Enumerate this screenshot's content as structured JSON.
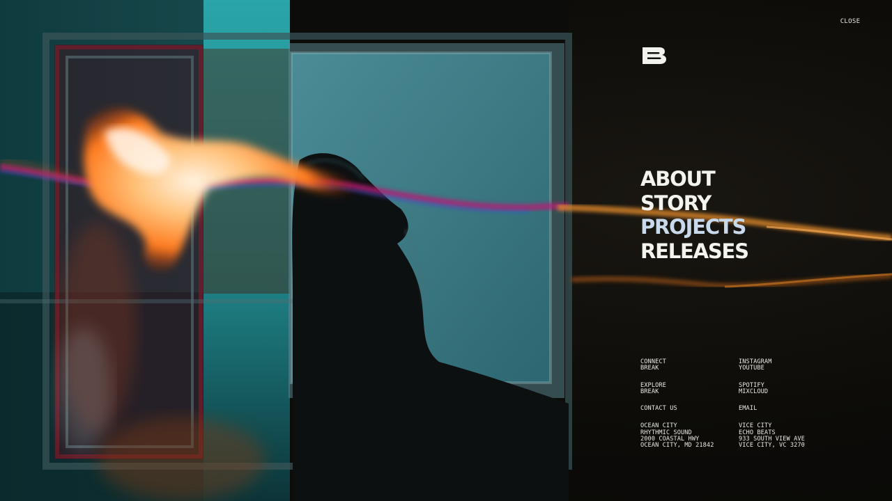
{
  "header": {
    "close_label": "CLOSE"
  },
  "logo": {
    "icon": "b-logo-icon",
    "color": "#f2f2ee"
  },
  "main_nav": {
    "items": [
      {
        "label": "ABOUT"
      },
      {
        "label": "STORY"
      },
      {
        "label": "PROJECTS",
        "active": true
      },
      {
        "label": "RELEASES"
      }
    ],
    "active_color": "#c7d9ea"
  },
  "footer": {
    "connect": {
      "line1": "CONNECT",
      "line2": "BREAK"
    },
    "social": {
      "instagram": "INSTAGRAM",
      "youtube": "YOUTUBE"
    },
    "explore": {
      "line1": "EXPLORE",
      "line2": "BREAK"
    },
    "music": {
      "spotify": "SPOTIFY",
      "mixcloud": "MIXCLOUD"
    },
    "contact": {
      "label": "CONTACT US",
      "email": "EMAIL"
    },
    "studios": [
      {
        "city": "OCEAN CITY",
        "name": "RHYTHMIC SOUND",
        "street": "2000 COASTAL HWY",
        "locality": "OCEAN CITY, MD 21842"
      },
      {
        "city": "VICE CITY",
        "name": "ECHO BEATS",
        "street": "933 SOUTH VIEW AVE",
        "locality": "VICE CITY, VC 3270"
      }
    ]
  },
  "colors": {
    "background": "#0b0b09",
    "teal": "#2f7f86",
    "flame": "#ff9a3a",
    "magenta": "#c2185b"
  }
}
